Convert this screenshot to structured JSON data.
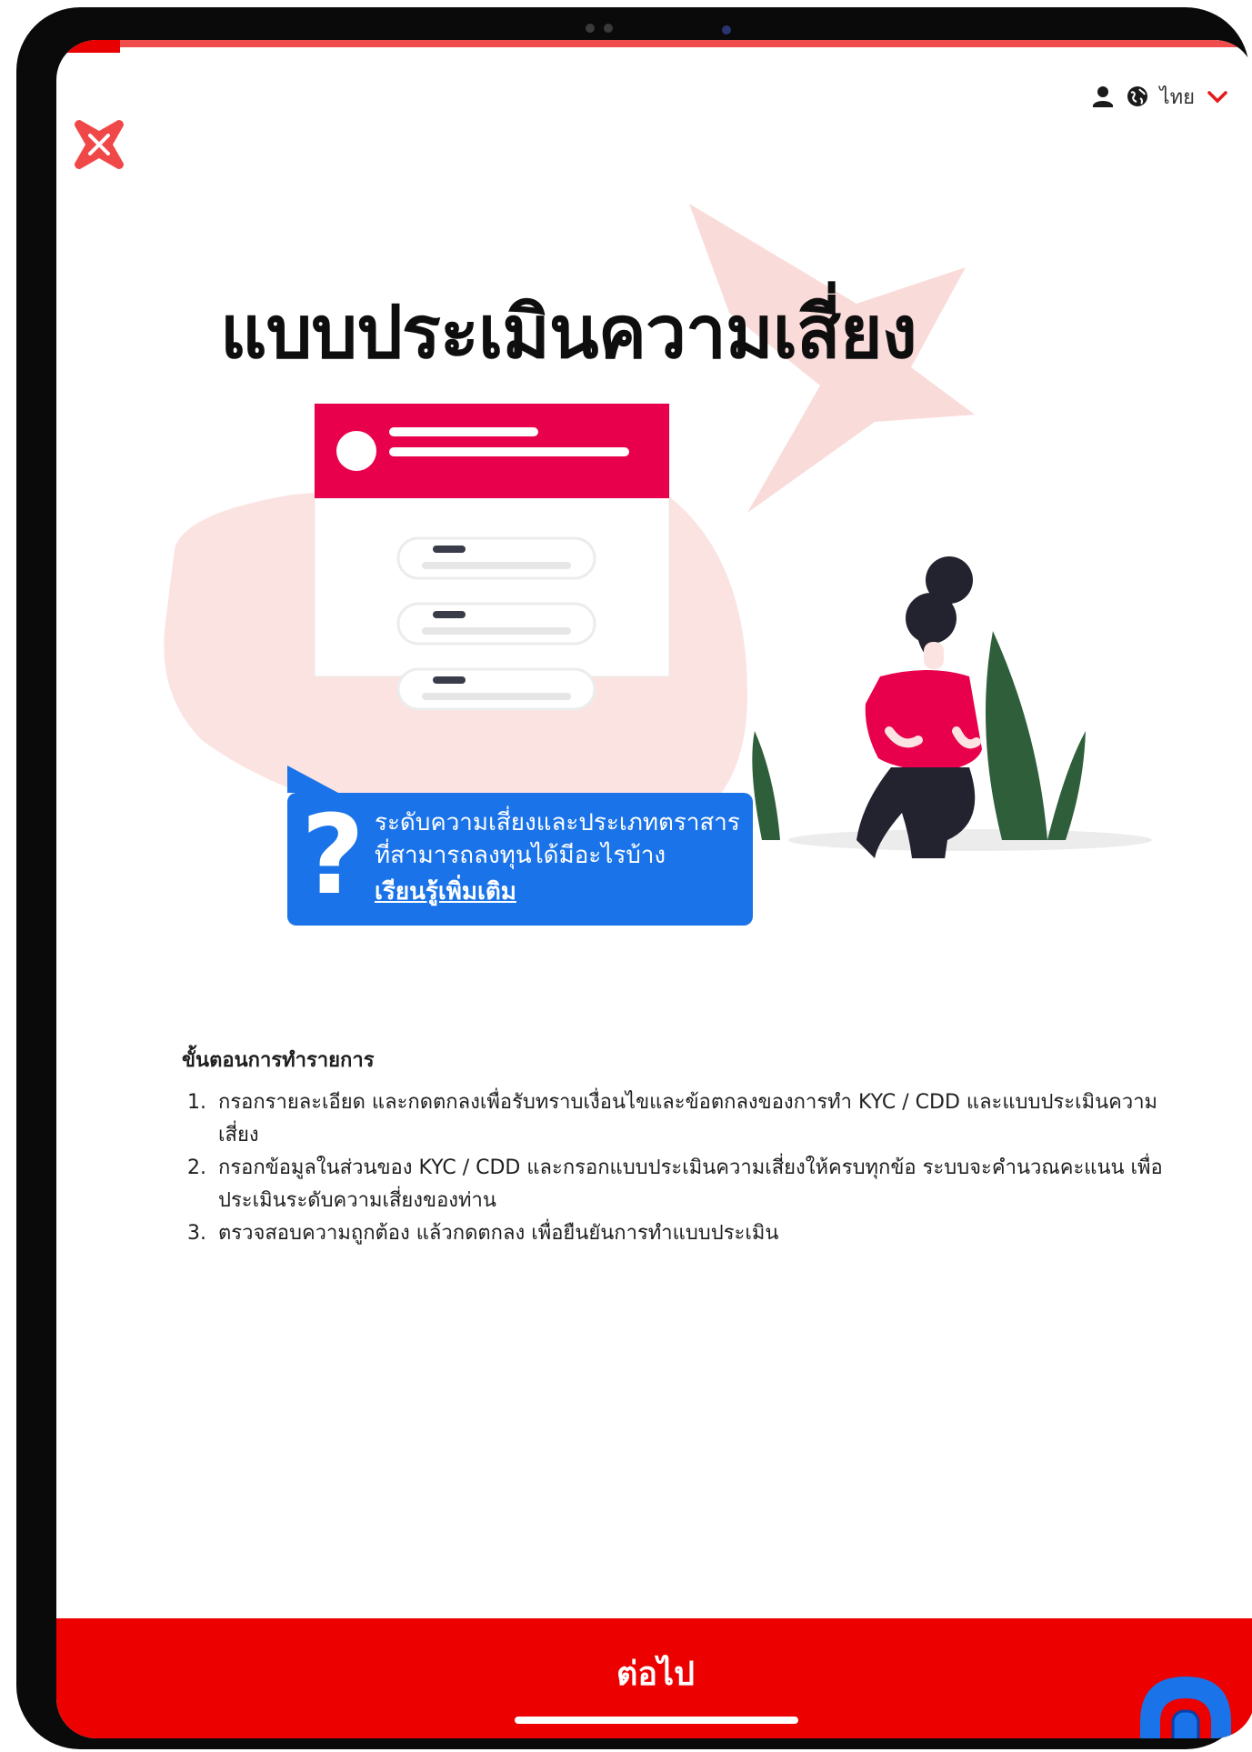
{
  "header": {
    "language": "ไทย",
    "icons": [
      "user-icon",
      "globe-icon",
      "chevron-down-icon"
    ]
  },
  "hero": {
    "title": "แบบประเมินความเสี่ยง"
  },
  "info_card": {
    "line1": "ระดับความเสี่ยงและประเภทตราสาร",
    "line2": "ที่สามารถลงทุนได้มีอะไรบ้าง",
    "link": "เรียนรู้เพิ่มเติม"
  },
  "steps": {
    "title": "ขั้นตอนการทำรายการ",
    "items": [
      "กรอกรายละเอียด และกดตกลงเพื่อรับทราบเงื่อนไขและข้อตกลงของการทำ KYC / CDD และแบบประเมินความเสี่ยง",
      "กรอกข้อมูลในส่วนของ KYC / CDD และกรอกแบบประเมินความเสี่ยงให้ครบทุกข้อ ระบบจะคำนวณคะแนน เพื่อประเมินระดับความเสี่ยงของท่าน",
      "ตรวจสอบความถูกต้อง แล้วกดตกลง เพื่อยืนยันการทำแบบประเมิน"
    ]
  },
  "footer": {
    "next_label": "ต่อไป"
  },
  "colors": {
    "brand_red": "#ec0000",
    "card_pink": "#e8004c",
    "info_blue": "#1a73e8",
    "blob_pink": "#fbe3e1"
  }
}
